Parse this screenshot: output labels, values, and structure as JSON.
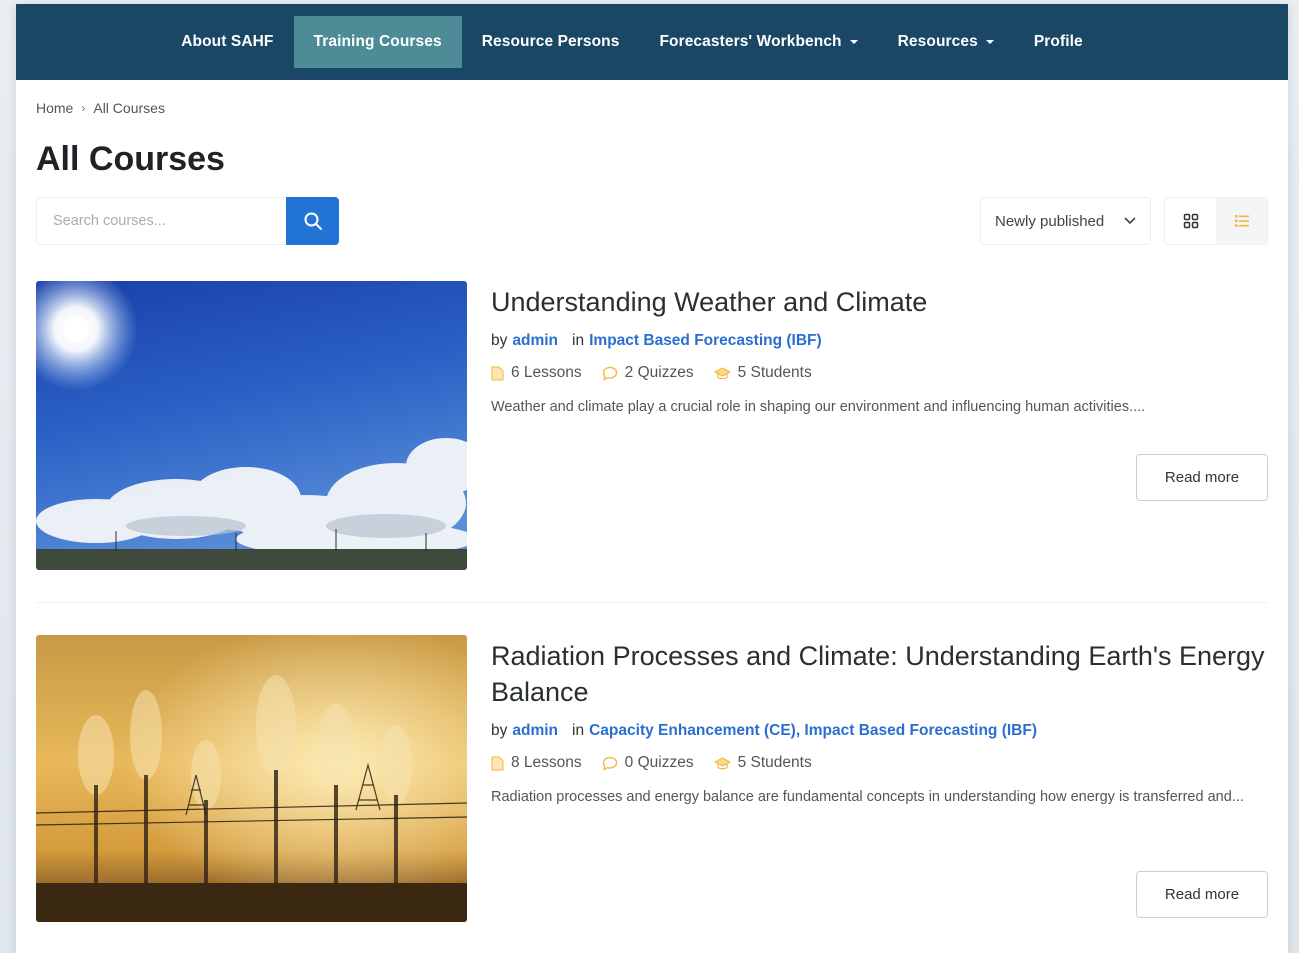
{
  "nav": {
    "items": [
      {
        "label": "About SAHF",
        "active": false,
        "dropdown": false
      },
      {
        "label": "Training Courses",
        "active": true,
        "dropdown": false
      },
      {
        "label": "Resource Persons",
        "active": false,
        "dropdown": false
      },
      {
        "label": "Forecasters' Workbench",
        "active": false,
        "dropdown": true
      },
      {
        "label": "Resources",
        "active": false,
        "dropdown": true
      },
      {
        "label": "Profile",
        "active": false,
        "dropdown": false
      }
    ]
  },
  "breadcrumb": {
    "home": "Home",
    "current": "All Courses"
  },
  "page_title": "All Courses",
  "search": {
    "placeholder": "Search courses...",
    "value": "",
    "button_icon": "search-icon"
  },
  "sort": {
    "selected": "Newly published"
  },
  "view_toggle": {
    "options": [
      "grid-view-icon",
      "list-view-icon"
    ],
    "active": "list"
  },
  "colors": {
    "nav_bg": "#1b4766",
    "nav_active": "#4d8c97",
    "accent": "#2174d6",
    "link": "#2a6fd0",
    "icon_orange": "#f3b63c"
  },
  "courses": [
    {
      "title": "Understanding Weather and Climate",
      "by_label": "by",
      "author": "admin",
      "in_label": "in",
      "categories": "Impact Based Forecasting (IBF)",
      "lessons": "6 Lessons",
      "quizzes": "2 Quizzes",
      "students": "5 Students",
      "excerpt": "Weather and climate play a crucial role in shaping our environment and influencing human activities....",
      "read_more": "Read more",
      "image": "blue-sky-clouds-image"
    },
    {
      "title": "Radiation Processes and Climate: Understanding Earth's Energy Balance",
      "by_label": "by",
      "author": "admin",
      "in_label": "in",
      "categories": "Capacity Enhancement (CE), Impact Based Forecasting (IBF)",
      "lessons": "8 Lessons",
      "quizzes": "0 Quizzes",
      "students": "5 Students",
      "excerpt": "Radiation processes and energy balance are fundamental concepts in understanding how energy is transferred and...",
      "read_more": "Read more",
      "image": "industrial-smokestacks-image"
    }
  ]
}
